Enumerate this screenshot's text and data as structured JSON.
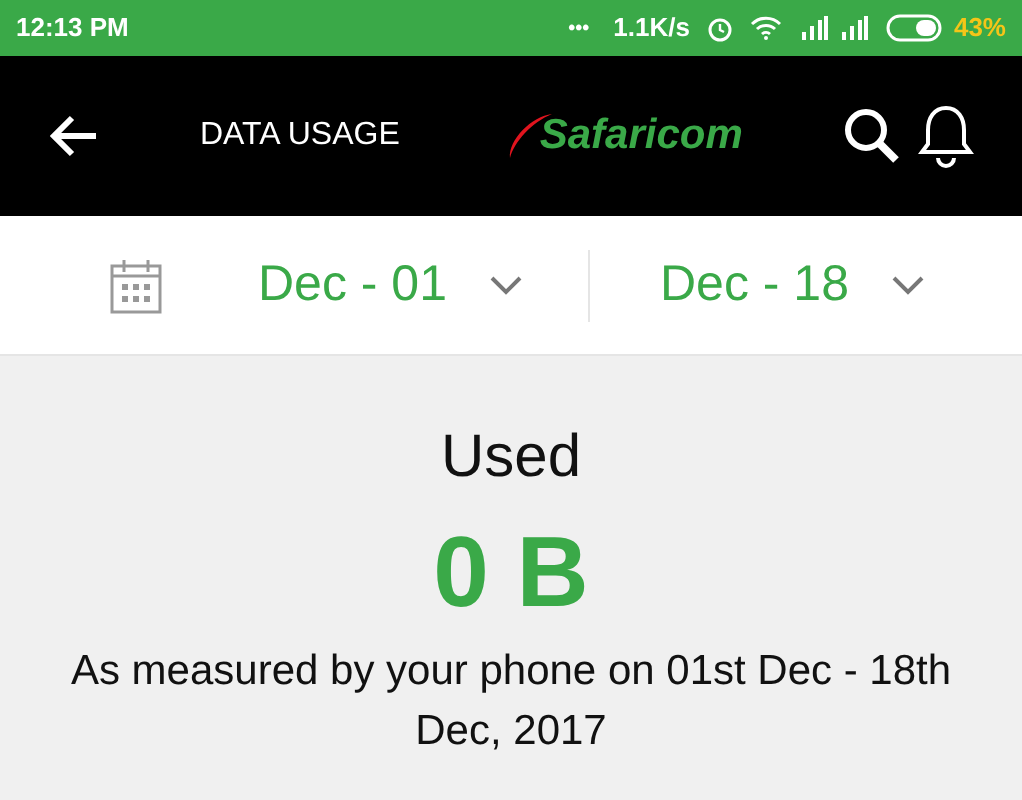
{
  "status_bar": {
    "time": "12:13 PM",
    "dots": "•••",
    "speed": "1.1K/s",
    "battery_percent": "43%"
  },
  "header": {
    "title": "DATA USAGE",
    "logo": "Safaricom"
  },
  "date_range": {
    "from": "Dec - 01",
    "to": "Dec - 18"
  },
  "usage": {
    "label": "Used",
    "amount": "0 B",
    "note": "As measured by your phone on 01st Dec - 18th Dec, 2017"
  }
}
